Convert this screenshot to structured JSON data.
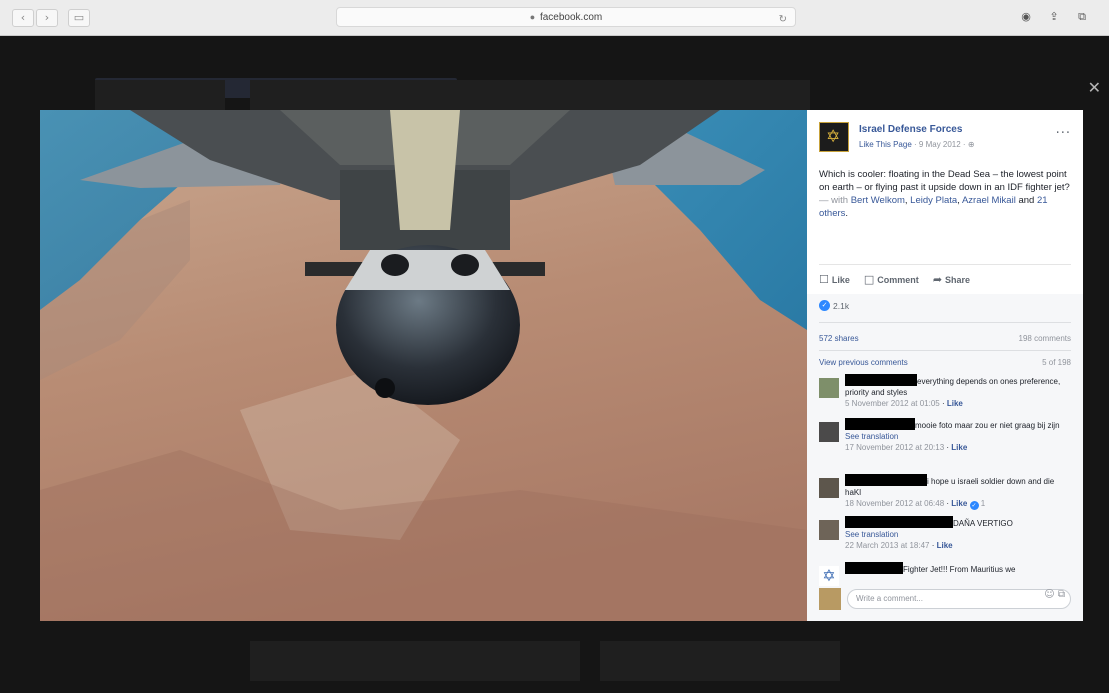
{
  "browser": {
    "url": "facebook.com",
    "back_icon": "‹",
    "forward_icon": "›",
    "sidebar_icon": "▭",
    "reload_icon": "↻",
    "tools": [
      "◉",
      "⇪",
      "⧉"
    ]
  },
  "post": {
    "page_name": "Israel Defense Forces",
    "like_page": "Like This Page",
    "date": "· 9 May 2012 · ⊕",
    "more": "···",
    "text": "Which is cooler: floating in the Dead Sea – the lowest point on earth – or flying past it upside down in an IDF fighter jet?",
    "with_label": "— with",
    "tagged_1": "Bert Welkom",
    "tagged_2": "Leidy Plata",
    "tagged_3": "Azrael Mikail",
    "and_label": "and",
    "others": "21 others"
  },
  "actions": {
    "like": "Like",
    "comment": "Comment",
    "share": "Share"
  },
  "stats": {
    "reaction_count": "2.1k",
    "shares": "572 shares",
    "comments": "198 comments",
    "view_previous": "View previous comments",
    "shown_count": "5 of 198"
  },
  "comments": [
    {
      "text": "everything depends on ones preference, priority and styles",
      "time": "5 November 2012 at 01:05",
      "like": "Like"
    },
    {
      "text": "mooie foto maar zou er niet graag bij zijn",
      "see_translation": "See translation",
      "time": "17 November 2012 at 20:13",
      "like": "Like"
    },
    {
      "text": "i hope u israeli soldier down and die haKl",
      "time": "18 November 2012 at 06:48",
      "like": "Like",
      "reactions": "1"
    },
    {
      "text": "DAÑA VERTIGO",
      "see_translation": "See translation",
      "time": "22 March 2013 at 18:47",
      "like": "Like"
    },
    {
      "text": "Fighter Jet!!! From Mauritius we"
    }
  ],
  "write_comment": {
    "placeholder": "Write a comment...",
    "icons": "☺ ⧉"
  },
  "close": "✕"
}
